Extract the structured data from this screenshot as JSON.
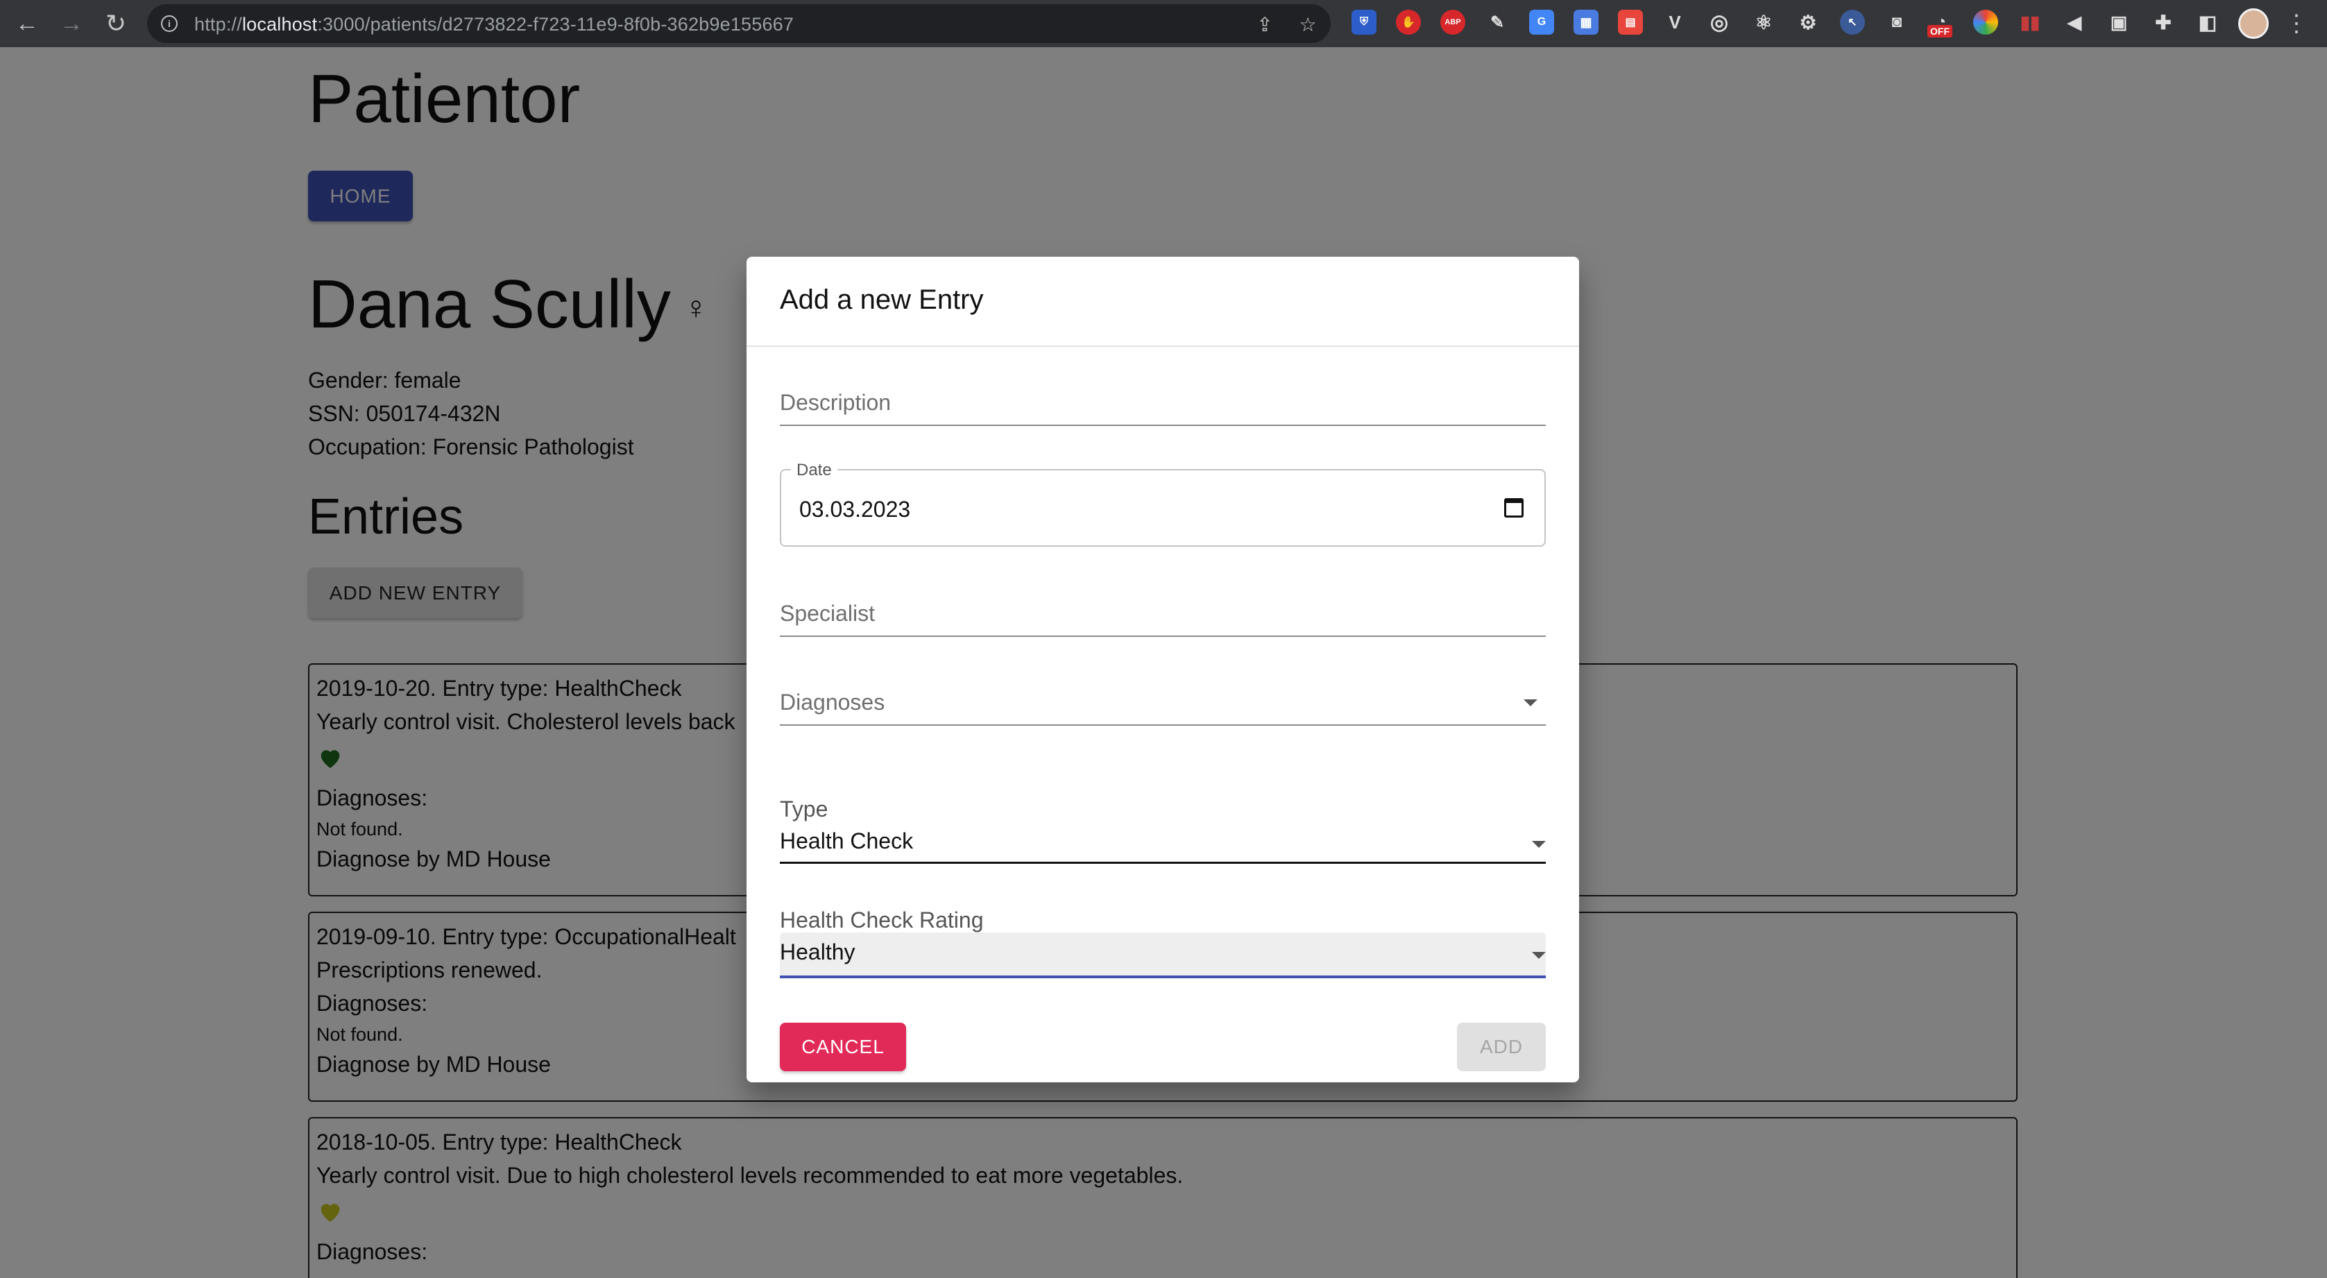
{
  "browser": {
    "url_prefix": "http://",
    "url_host": "localhost",
    "url_rest": ":3000/patients/d2773822-f723-11e9-8f0b-362b9e155667",
    "extensions": [
      "bitwarden-icon",
      "adblock-icon",
      "abp-icon",
      "pen-icon",
      "translate-icon",
      "calendar-icon",
      "clipboard-icon",
      "vue-icon",
      "target-icon",
      "react-icon",
      "gear-icon",
      "cursor-icon",
      "camera-icon",
      "off-icon",
      "color-icon",
      "audio-wave-icon",
      "volume-icon",
      "document-icon",
      "puzzle-icon",
      "sidepanel-icon"
    ],
    "off_badge": "OFF",
    "abp_label": "ABP"
  },
  "app": {
    "title": "Patientor",
    "home_button": "HOME"
  },
  "patient": {
    "name": "Dana Scully",
    "gender_symbol": "♀",
    "gender_line": "Gender: female",
    "ssn_line": "SSN: 050174-432N",
    "occupation_line": "Occupation: Forensic Pathologist"
  },
  "entries": {
    "title": "Entries",
    "add_button": "ADD NEW ENTRY",
    "items": [
      {
        "header": "2019-10-20. Entry type: HealthCheck",
        "description": "Yearly control visit. Cholesterol levels back",
        "heart_color": "#1f6b1f",
        "diagnoses_label": "Diagnoses:",
        "not_found": "Not found.",
        "specialist_line": "Diagnose by MD House"
      },
      {
        "header": "2019-09-10. Entry type: OccupationalHealt",
        "description": "Prescriptions renewed.",
        "diagnoses_label": "Diagnoses:",
        "not_found": "Not found.",
        "specialist_line": "Diagnose by MD House"
      },
      {
        "header": "2018-10-05. Entry type: HealthCheck",
        "description": "Yearly control visit. Due to high cholesterol levels recommended to eat more vegetables.",
        "heart_color": "#c8c81e",
        "diagnoses_label": "Diagnoses:"
      }
    ]
  },
  "dialog": {
    "title": "Add a new Entry",
    "description_placeholder": "Description",
    "date_label": "Date",
    "date_value": "03.03.2023",
    "specialist_placeholder": "Specialist",
    "diagnoses_placeholder": "Diagnoses",
    "type_label": "Type",
    "type_value": "Health Check",
    "rating_label": "Health Check Rating",
    "rating_value": "Healthy",
    "cancel_button": "CANCEL",
    "add_button": "ADD"
  }
}
